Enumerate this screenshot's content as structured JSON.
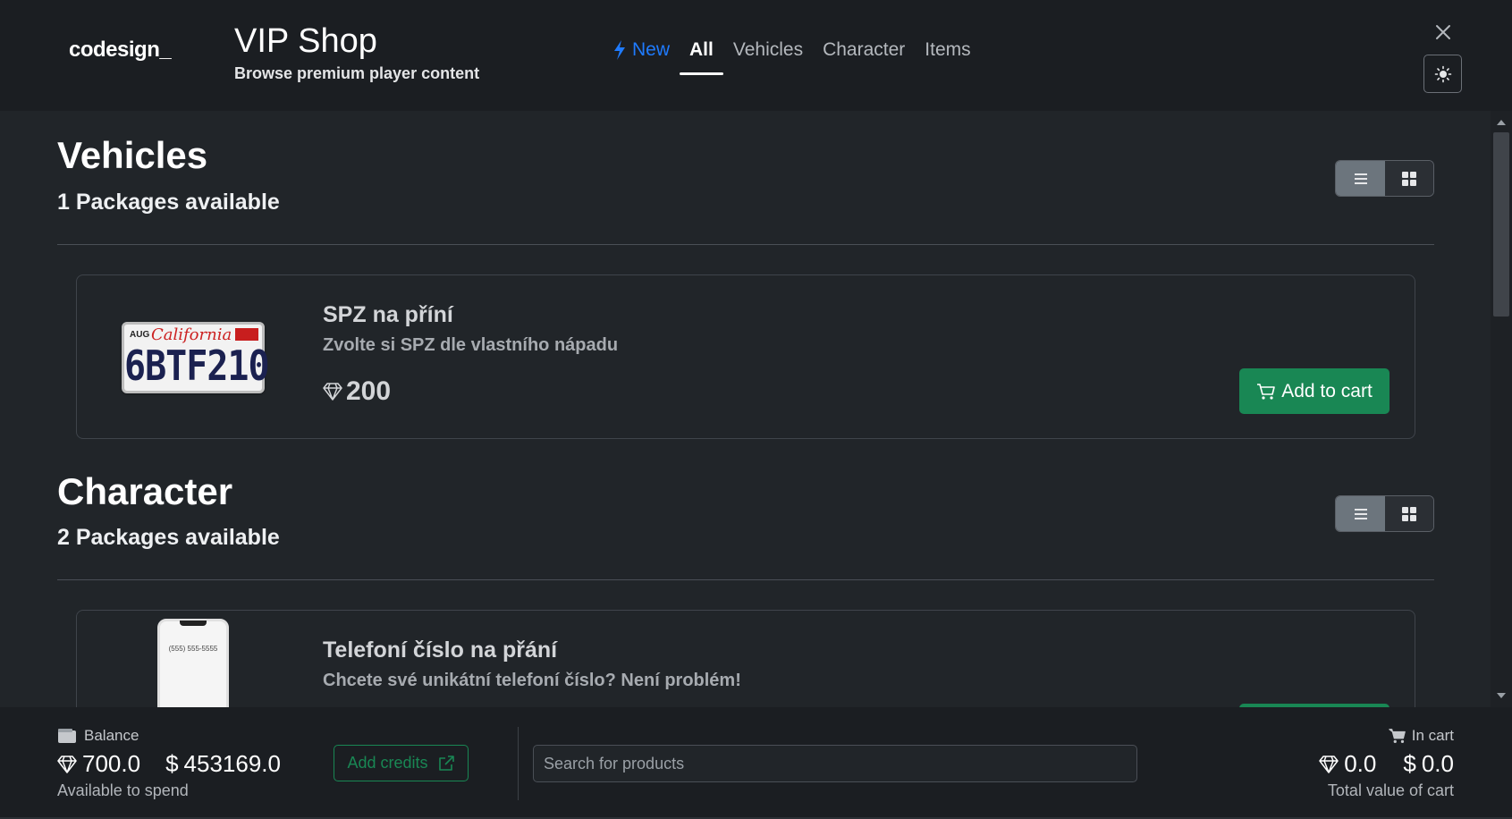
{
  "header": {
    "logo": "codesign_",
    "title": "VIP Shop",
    "subtitle": "Browse premium player content",
    "nav": {
      "new_label": "New",
      "all_label": "All",
      "vehicles_label": "Vehicles",
      "character_label": "Character",
      "items_label": "Items",
      "active": "All"
    }
  },
  "sections": [
    {
      "title": "Vehicles",
      "subtitle": "1 Packages available",
      "items": [
        {
          "name": "SPZ na příní",
          "description": "Zvolte si SPZ dle vlastního nápadu",
          "price": "200",
          "button": "Add to cart",
          "image": {
            "plate_month": "AUG",
            "plate_state": "California",
            "plate_number": "6BTF210"
          }
        }
      ]
    },
    {
      "title": "Character",
      "subtitle": "2 Packages available",
      "items": [
        {
          "name": "Telefoní číslo na přání",
          "description": "Chcete své unikátní telefoní číslo? Není problém!",
          "image": {
            "phone_number": "(555) 555-5555"
          }
        }
      ]
    }
  ],
  "footer": {
    "balance_label": "Balance",
    "balance_credits": "700.0",
    "balance_dollars": "453169.0",
    "balance_sub": "Available to spend",
    "add_credits_label": "Add credits",
    "search_placeholder": "Search for products",
    "cart_label": "In cart",
    "cart_credits": "0.0",
    "cart_dollars": "0.0",
    "cart_sub": "Total value of cart",
    "currency_symbol": "$"
  },
  "colors": {
    "accent_blue": "#1f7bff",
    "success_green": "#198754",
    "background": "#212529",
    "header_bg": "#1b1e22"
  },
  "view_mode": "list"
}
